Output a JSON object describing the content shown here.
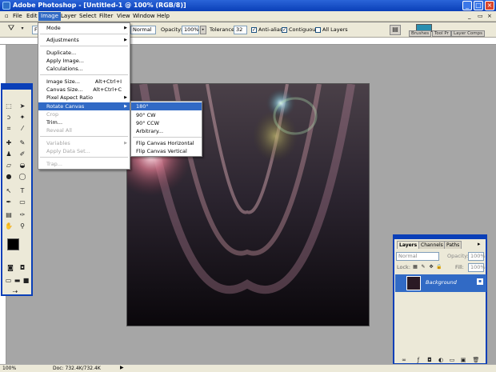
{
  "app_title": "Adobe Photoshop - [Untitled-1 @ 100% (RGB/8)]",
  "menubar": [
    "File",
    "Edit",
    "Image",
    "Layer",
    "Select",
    "Filter",
    "View",
    "Window",
    "Help"
  ],
  "active_menu": "Image",
  "options": {
    "mode_value": "Normal",
    "opacity_label": "Opacity:",
    "opacity_value": "100%",
    "tolerance_label": "Tolerance:",
    "tolerance_value": "32",
    "antialias_label": "Anti-alias",
    "contiguous_label": "Contiguous",
    "all_layers_label": "All Layers",
    "tab_brushes": "Brushes",
    "tab_toolpresets": "Tool Pr",
    "tab_layercomps": "Layer Comps"
  },
  "image_menu": [
    {
      "label": "Mode",
      "arrow": true
    },
    {
      "label": "Adjustments",
      "arrow": true
    },
    {
      "label": "Duplicate..."
    },
    {
      "label": "Apply Image..."
    },
    {
      "label": "Calculations..."
    },
    {
      "label": "Image Size...",
      "shortcut": "Alt+Ctrl+I"
    },
    {
      "label": "Canvas Size...",
      "shortcut": "Alt+Ctrl+C"
    },
    {
      "label": "Pixel Aspect Ratio",
      "arrow": true
    },
    {
      "label": "Rotate Canvas",
      "arrow": true,
      "highlighted": true
    },
    {
      "label": "Crop",
      "disabled": true
    },
    {
      "label": "Trim..."
    },
    {
      "label": "Reveal All",
      "disabled": true
    },
    {
      "label": "Variables",
      "arrow": true,
      "disabled": true
    },
    {
      "label": "Apply Data Set...",
      "disabled": true
    },
    {
      "label": "Trap...",
      "disabled": true
    }
  ],
  "rotate_submenu": [
    {
      "label": "180°",
      "highlighted": true
    },
    {
      "label": "90° CW"
    },
    {
      "label": "90° CCW"
    },
    {
      "label": "Arbitrary..."
    },
    {
      "label": "Flip Canvas Horizontal"
    },
    {
      "label": "Flip Canvas Vertical"
    }
  ],
  "layers_panel": {
    "tabs": [
      "Layers",
      "Channels",
      "Paths"
    ],
    "blend_mode": "Normal",
    "opacity_label": "Opacity:",
    "opacity_value": "100%",
    "lock_label": "Lock:",
    "fill_label": "Fill:",
    "fill_value": "100%",
    "layer_name": "Background"
  },
  "status": {
    "zoom": "100%",
    "doc": "Doc: 732.4K/732.4K"
  },
  "colors": {
    "accent": "#316ac5",
    "titlebar": "#0a3fb8"
  }
}
